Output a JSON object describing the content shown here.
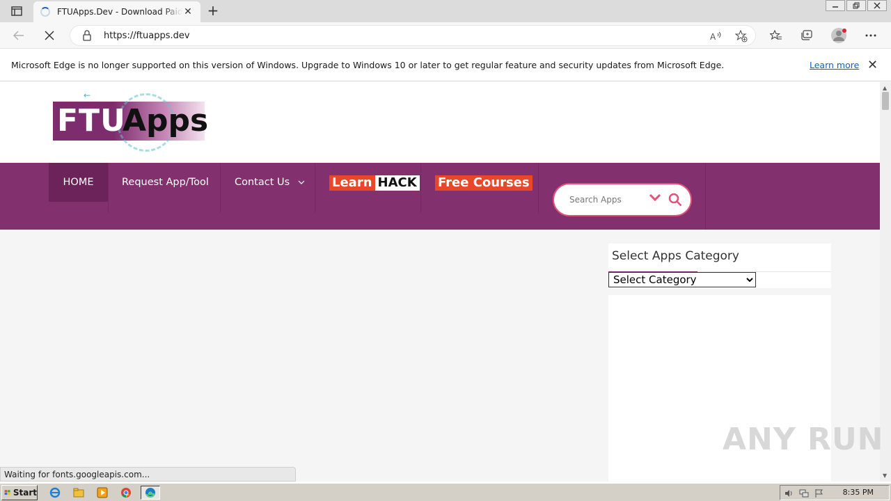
{
  "browser": {
    "tab_title": "FTUApps.Dev - Download Paid Apps",
    "tab_close": "✕",
    "new_tab": "+",
    "url": "https://ftuapps.dev"
  },
  "infobar": {
    "message": "Microsoft Edge is no longer supported on this version of Windows. Upgrade to Windows 10 or later to get regular feature and security updates from Microsoft Edge.",
    "link": "Learn more",
    "close": "✕"
  },
  "site": {
    "logo_left": "FTU",
    "logo_right": "Apps",
    "nav": [
      {
        "label": "HOME"
      },
      {
        "label": "Request App/Tool"
      },
      {
        "label": "Contact Us"
      },
      {
        "label_a": "Learn",
        "label_b": "HACK"
      },
      {
        "label": "Free Courses"
      }
    ],
    "search_placeholder": "Search Apps",
    "sidebar_heading": "Select Apps Category",
    "category_select": "Select Category"
  },
  "status_text": "Waiting for fonts.googleapis.com...",
  "watermark": "ANY RUN",
  "taskbar": {
    "start": "Start",
    "clock": "8:35 PM"
  },
  "colors": {
    "brand_purple": "#83306f",
    "accent_red": "#e0527a",
    "badge_orange": "#e8472a"
  }
}
